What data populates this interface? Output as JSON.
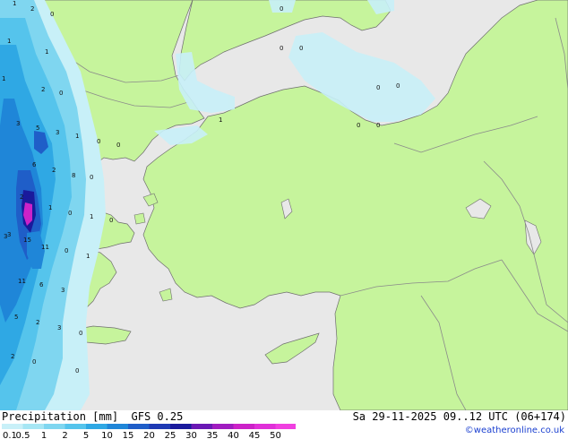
{
  "map": {
    "colors": {
      "sea": "#e8e8e8",
      "land": "#c6f49c",
      "border": "#8a8a8a",
      "coast": "#6e6e6e"
    },
    "value_labels": [
      "1",
      "2",
      "0",
      "1",
      "1",
      "1",
      "2",
      "0",
      "3",
      "5",
      "3",
      "1",
      "0",
      "0",
      "6",
      "2",
      "0",
      "8",
      "2",
      "1",
      "0",
      "3",
      "1",
      "0",
      "3",
      "15",
      "11",
      "0",
      "1",
      "11",
      "6",
      "3",
      "5",
      "2",
      "3",
      "0",
      "2",
      "0",
      "0",
      "0",
      "0",
      "0",
      "0",
      "0",
      "0",
      "0",
      "1"
    ]
  },
  "footer": {
    "title": "Precipitation [mm]  GFS 0.25",
    "valid": "Sa 29-11-2025 09..12 UTC (06+174)",
    "credit": "©weatheronline.co.uk",
    "scale": {
      "ticks": [
        "0.1",
        "0.5",
        "1",
        "2",
        "5",
        "10",
        "15",
        "20",
        "25",
        "30",
        "35",
        "40",
        "45",
        "50"
      ],
      "colors": [
        "#c8f0f8",
        "#a6e6f4",
        "#7fd6f0",
        "#55c4ec",
        "#2fa8e4",
        "#1f86d8",
        "#1f5ec8",
        "#1e3ab4",
        "#1a1a9c",
        "#6a18b4",
        "#a01cc0",
        "#cc22c8",
        "#e030d8",
        "#f040e0"
      ]
    }
  }
}
